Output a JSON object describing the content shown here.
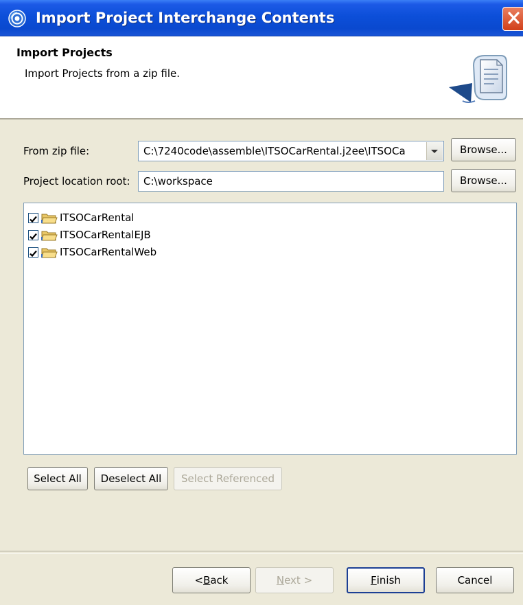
{
  "window": {
    "title": "Import Project Interchange Contents",
    "close_glyph": "✕"
  },
  "banner": {
    "title": "Import Projects",
    "description": "Import Projects from a zip file."
  },
  "form": {
    "zip_label": "From zip file:",
    "zip_value": "C:\\7240code\\assemble\\ITSOCarRental.j2ee\\ITSOCa",
    "browse1_label": "Browse...",
    "root_label": "Project location root:",
    "root_value": "C:\\workspace",
    "browse2_label": "Browse..."
  },
  "projects": [
    {
      "label": "ITSOCarRental",
      "checked": true
    },
    {
      "label": "ITSOCarRentalEJB",
      "checked": true
    },
    {
      "label": "ITSOCarRentalWeb",
      "checked": true
    }
  ],
  "selection_buttons": {
    "select_all": "Select All",
    "deselect_all": "Deselect All",
    "select_referenced": "Select Referenced"
  },
  "footer": {
    "back_prefix": "< ",
    "back_mnemonic": "B",
    "back_rest": "ack",
    "next_mnemonic": "N",
    "next_rest": "ext >",
    "finish_mnemonic": "F",
    "finish_rest": "inish",
    "cancel": "Cancel"
  },
  "icons": {
    "app": "eclipse-sphere-icon",
    "banner": "import-wizard-icon",
    "folder": "project-folder-icon",
    "checkbox": "checkmark-icon"
  },
  "colors": {
    "titlebar": "#0a49cf",
    "dialog_bg": "#ece9d8",
    "close_button": "#d1401a"
  }
}
